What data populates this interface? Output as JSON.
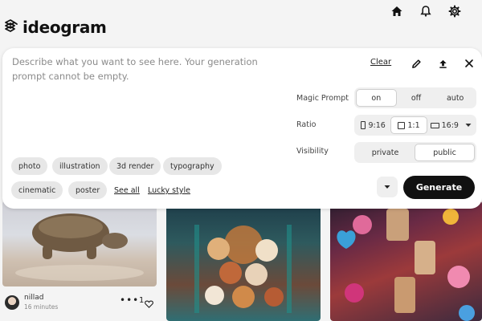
{
  "header": {
    "brand": "ideogram",
    "icons": [
      "home-icon",
      "bell-icon",
      "gear-icon"
    ]
  },
  "prompt": {
    "placeholder": "Describe what you want to see here. Your generation prompt cannot be empty.",
    "value": ""
  },
  "toolbar": {
    "clear_label": "Clear",
    "icons": [
      "pencil-icon",
      "upload-icon",
      "close-icon"
    ]
  },
  "magic_prompt": {
    "label": "Magic Prompt",
    "options": [
      "on",
      "off",
      "auto"
    ],
    "selected": "on"
  },
  "ratio": {
    "label": "Ratio",
    "options": [
      "9:16",
      "1:1",
      "16:9"
    ],
    "selected": "1:1"
  },
  "visibility": {
    "label": "Visibility",
    "options": [
      "private",
      "public"
    ],
    "selected": "public"
  },
  "style_chips": [
    "photo",
    "illustration",
    "3d render",
    "typography",
    "cinematic",
    "poster"
  ],
  "links": {
    "see_all": "See all",
    "lucky_style": "Lucky style"
  },
  "generate_label": "Generate",
  "feed": {
    "first_card": {
      "username": "nillad",
      "time": "16 minutes",
      "likes": "1"
    }
  },
  "colors": {
    "accent": "#111111",
    "chip_bg": "#e7e7e7",
    "segment_bg": "#efefef"
  }
}
